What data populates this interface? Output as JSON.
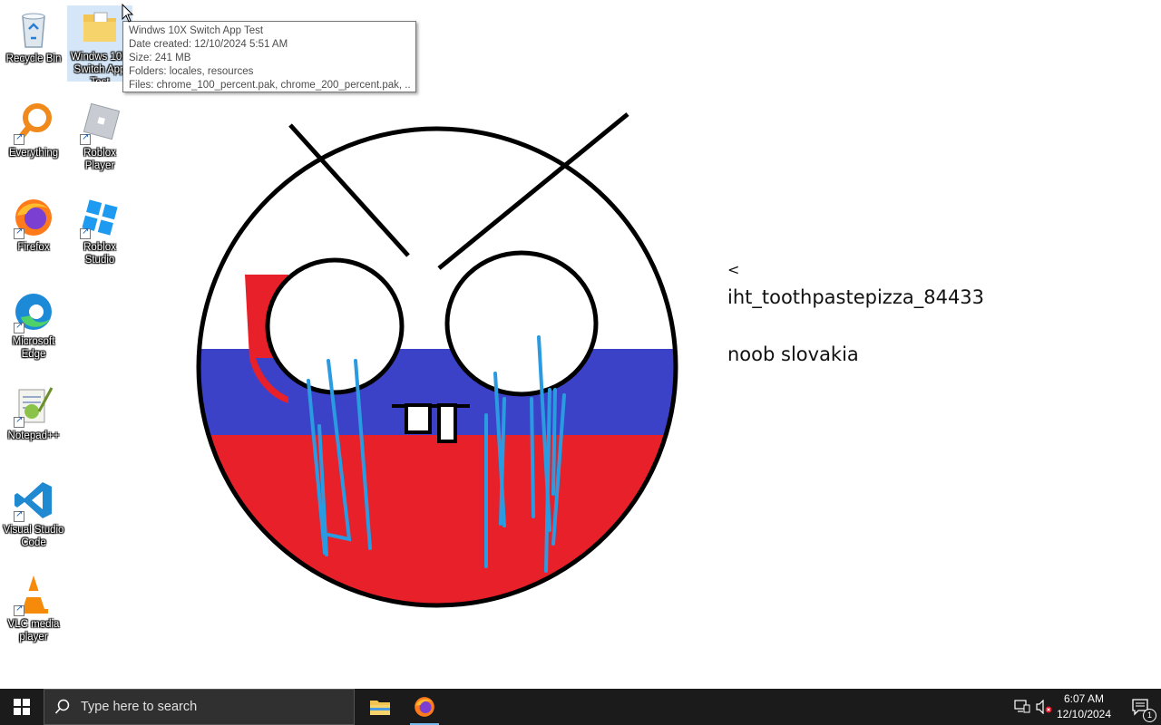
{
  "desktop": {
    "icons": [
      {
        "label": "Recycle Bin"
      },
      {
        "label": "Windws 10X Switch App Test"
      },
      {
        "label": "Everything"
      },
      {
        "label": "Roblox Player"
      },
      {
        "label": "Firefox"
      },
      {
        "label": "Roblox Studio"
      },
      {
        "label": "Microsoft Edge"
      },
      {
        "label": "Notepad++"
      },
      {
        "label": "Visual Studio Code"
      },
      {
        "label": "VLC media player"
      }
    ],
    "tooltip": {
      "name": "Windws 10X Switch App Test",
      "date_created": "Date created: 12/10/2024 5:51 AM",
      "size": "Size: 241 MB",
      "folders": "Folders: locales, resources",
      "files": "Files: chrome_100_percent.pak, chrome_200_percent.pak, ..."
    },
    "wallpaper": {
      "arrow": "<",
      "username": "iht_toothpastepizza_84433",
      "caption": "noob slovakia",
      "flag_colors": {
        "white": "#ffffff",
        "blue": "#3c42c8",
        "red": "#e8202a"
      }
    }
  },
  "taskbar": {
    "search_placeholder": "Type here to search",
    "apps": [
      "File Explorer",
      "Firefox"
    ],
    "clock": {
      "time": "6:07 AM",
      "date": "12/10/2024"
    },
    "notification_count": "1"
  }
}
